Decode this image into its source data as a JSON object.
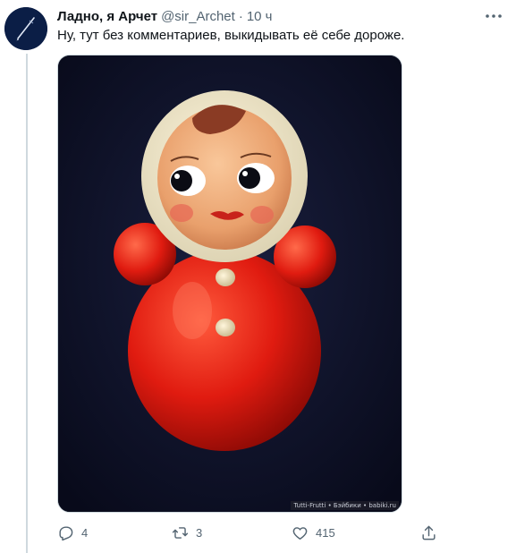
{
  "tweet": {
    "display_name": "Ладно, я Арчет",
    "handle": "@sir_Archet",
    "separator": "·",
    "time": "10 ч",
    "text": "Ну, тут без комментариев, выкидывать её себе дороже.",
    "watermark": "Tutti-Frutti • Бэйбики • babiki.ru"
  },
  "actions": {
    "replies": "4",
    "retweets": "3",
    "likes": "415"
  },
  "icons": {
    "avatar": "pen-avatar",
    "more": "more-icon",
    "reply": "reply-icon",
    "retweet": "retweet-icon",
    "like": "heart-icon",
    "share": "share-icon"
  },
  "colors": {
    "text_primary": "#0f1419",
    "text_secondary": "#536471",
    "avatar_bg": "#0b1e46",
    "toy_red": "#e01b10"
  }
}
